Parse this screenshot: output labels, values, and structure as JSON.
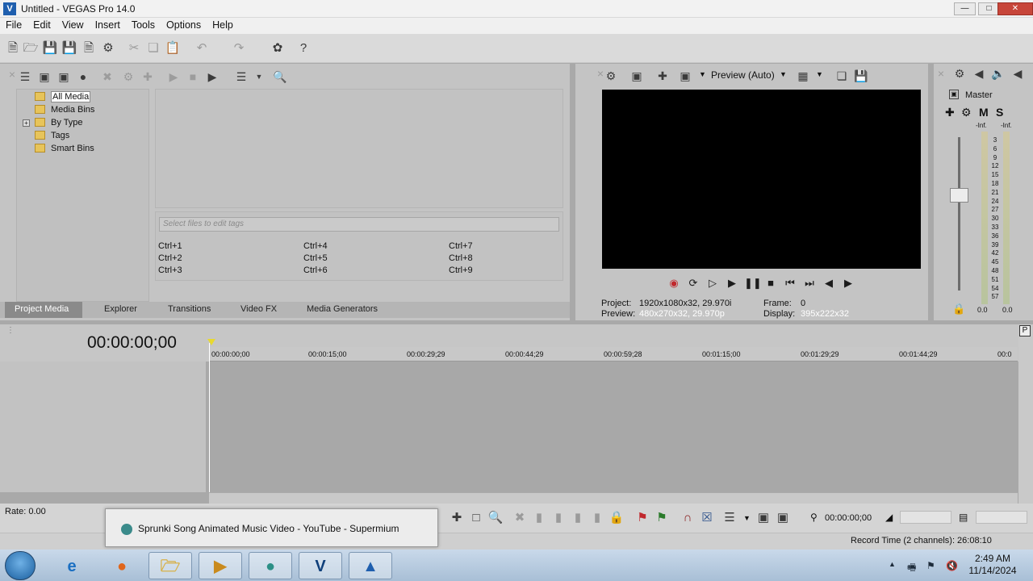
{
  "window": {
    "title": "Untitled - VEGAS Pro 14.0",
    "app_icon": "vegas-logo-icon",
    "controls": {
      "minimize": "minimize-icon",
      "maximize": "maximize-icon",
      "close": "close-icon"
    }
  },
  "menu": [
    "File",
    "Edit",
    "View",
    "Insert",
    "Tools",
    "Options",
    "Help"
  ],
  "media": {
    "tree": [
      {
        "label": "All Media"
      },
      {
        "label": "Media Bins"
      },
      {
        "label": "By Type"
      },
      {
        "label": "Tags"
      },
      {
        "label": "Smart Bins"
      }
    ],
    "tag_placeholder": "Select files to edit tags",
    "shortcuts": [
      "Ctrl+1",
      "Ctrl+2",
      "Ctrl+3",
      "Ctrl+4",
      "Ctrl+5",
      "Ctrl+6",
      "Ctrl+7",
      "Ctrl+8",
      "Ctrl+9"
    ],
    "tabs": [
      "Project Media",
      "Explorer",
      "Transitions",
      "Video FX",
      "Media Generators"
    ]
  },
  "preview": {
    "mode": "Preview (Auto)",
    "project_label": "Project:",
    "project_value": "1920x1080x32, 29.970i",
    "preview_label": "Preview:",
    "preview_value": "480x270x32, 29.970p",
    "frame_label": "Frame:",
    "frame_value": "0",
    "display_label": "Display:",
    "display_value": "395x222x32"
  },
  "master": {
    "title": "Master",
    "m_label": "M",
    "s_label": "S",
    "left_inf": "-Inf.",
    "right_inf": "-Inf.",
    "left_bottom": "0.0",
    "right_bottom": "0.0",
    "scale": [
      "3",
      "6",
      "9",
      "12",
      "15",
      "18",
      "21",
      "24",
      "27",
      "30",
      "33",
      "36",
      "39",
      "42",
      "45",
      "48",
      "51",
      "54",
      "57"
    ]
  },
  "timeline": {
    "timecode": "00:00:00;00",
    "ruler": [
      "00:00:00;00",
      "00:00:15;00",
      "00:00:29;29",
      "00:00:44;29",
      "00:00:59;28",
      "00:01:15;00",
      "00:01:29;29",
      "00:01:44;29",
      "00:0"
    ],
    "rate": "Rate: 0.00",
    "cursor_time": "00:00:00;00",
    "record_time": "Record Time (2 channels): 26:08:10"
  },
  "tooltip": {
    "text": "Sprunki Song Animated Music Video - YouTube - Supermium"
  },
  "taskbar": {
    "time": "2:49 AM",
    "date": "11/14/2024"
  },
  "colors": {
    "accent": "#1f5fae",
    "marker": "#e8d930"
  }
}
